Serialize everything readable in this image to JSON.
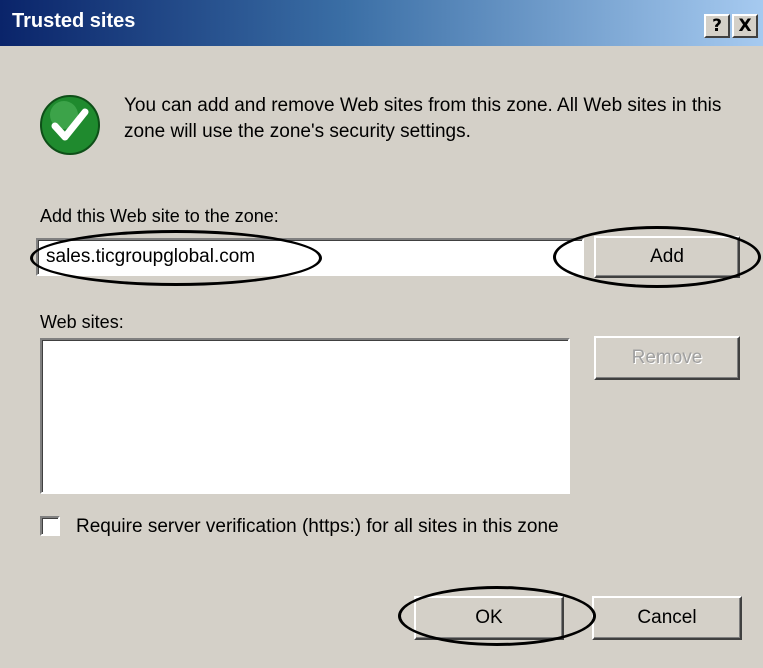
{
  "window": {
    "title": "Trusted sites",
    "help_glyph": "?",
    "close_glyph": "X"
  },
  "info": {
    "icon": "check-shield-icon",
    "text": "You can add and remove Web sites from this zone. All Web sites in this zone will use the zone's security settings."
  },
  "add_site": {
    "label": "Add this Web site to the zone:",
    "value": "sales.ticgroupglobal.com",
    "add_button": "Add"
  },
  "sites": {
    "label": "Web sites:",
    "items": [],
    "remove_button": "Remove"
  },
  "verification": {
    "label": "Require server verification (https:) for all sites in this zone",
    "checked": false
  },
  "buttons": {
    "ok": "OK",
    "cancel": "Cancel"
  },
  "colors": {
    "dialog_bg": "#d4d0c8",
    "title_start": "#0a246a",
    "title_end": "#a6caf0",
    "icon_green": "#1f8a2e"
  }
}
